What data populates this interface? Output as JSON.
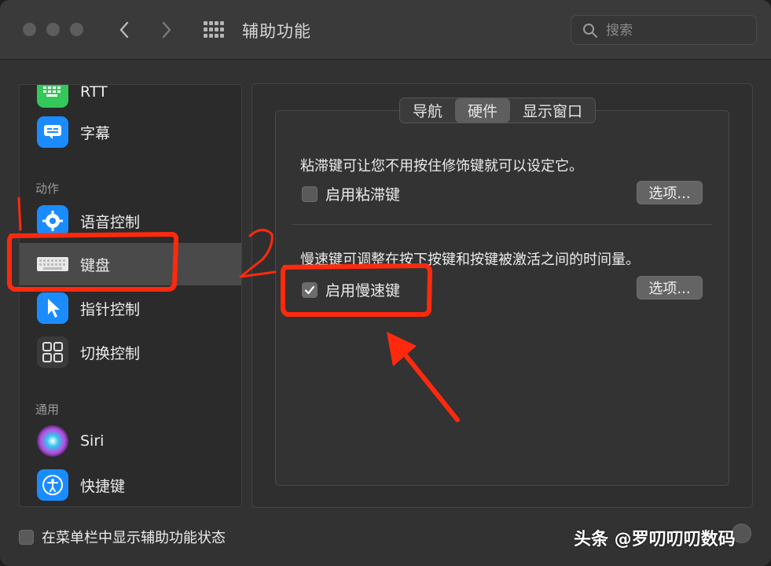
{
  "titlebar": {
    "title": "辅助功能",
    "search_placeholder": "搜索"
  },
  "sidebar": {
    "items_top": [
      {
        "label": "RTT"
      },
      {
        "label": "字幕"
      }
    ],
    "section_action": "动作",
    "items_action": [
      {
        "label": "语音控制"
      },
      {
        "label": "键盘"
      },
      {
        "label": "指针控制"
      },
      {
        "label": "切换控制"
      }
    ],
    "section_general": "通用",
    "items_general": [
      {
        "label": "Siri"
      },
      {
        "label": "快捷键"
      }
    ]
  },
  "tabs": [
    {
      "label": "导航"
    },
    {
      "label": "硬件"
    },
    {
      "label": "显示窗口"
    }
  ],
  "sticky": {
    "description": "粘滞键可让您不用按住修饰键就可以设定它。",
    "checkbox_label": "启用粘滞键",
    "checked": false,
    "options_label": "选项..."
  },
  "slow": {
    "description": "慢速键可调整在按下按键和按键被激活之间的时间量。",
    "checkbox_label": "启用慢速键",
    "checked": true,
    "options_label": "选项..."
  },
  "footer": {
    "status_label": "在菜单栏中显示辅助功能状态"
  },
  "watermark": "头条 @罗叨叨叨数码",
  "colors": {
    "annotation_red": "#ff2a0e"
  }
}
